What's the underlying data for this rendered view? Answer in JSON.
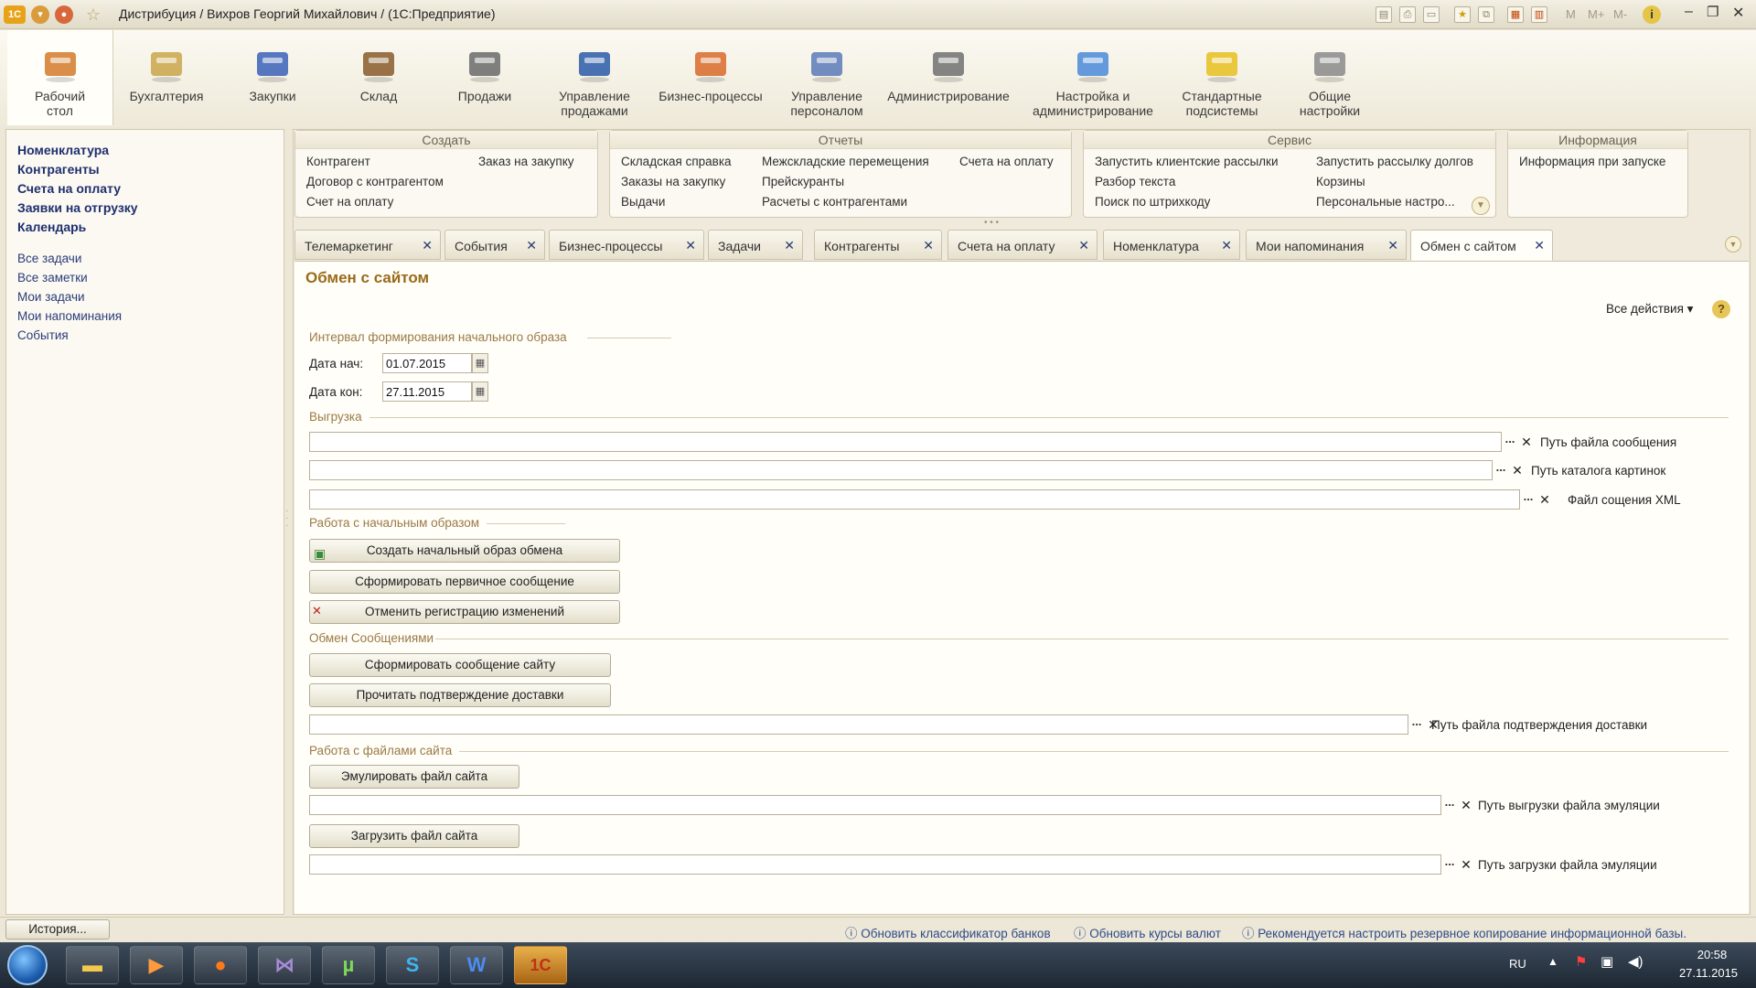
{
  "window": {
    "title": "Дистрибуция / Вихров Георгий Михайлович /  (1С:Предприятие)",
    "app_badge": "1С",
    "toolbar_letters": [
      "M",
      "M+",
      "M-"
    ]
  },
  "sections": [
    {
      "label": "Рабочий\nстол",
      "icon": "desktop-icon"
    },
    {
      "label": "Бухгалтерия",
      "icon": "coins-icon"
    },
    {
      "label": "Закупки",
      "icon": "truck-icon"
    },
    {
      "label": "Склад",
      "icon": "warehouse-icon"
    },
    {
      "label": "Продажи",
      "icon": "delivery-icon"
    },
    {
      "label": "Управление\nпродажами",
      "icon": "sales-chart-icon"
    },
    {
      "label": "Бизнес-процессы",
      "icon": "process-icon"
    },
    {
      "label": "Управление\nперсоналом",
      "icon": "people-icon"
    },
    {
      "label": "Администрирование",
      "icon": "tools-icon"
    },
    {
      "label": "Настройка и\nадминистрирование",
      "icon": "settings-server-icon"
    },
    {
      "label": "Стандартные\nподсистемы",
      "icon": "standard-icon"
    },
    {
      "label": "Общие\nнастройки",
      "icon": "gears-icon"
    }
  ],
  "sidebar": {
    "main": [
      "Номенклатура",
      "Контрагенты",
      "Счета на оплату",
      "Заявки на отгрузку",
      "Календарь"
    ],
    "secondary": [
      "Все задачи",
      "Все заметки",
      "Мои задачи",
      "Мои напоминания",
      "События"
    ],
    "history_button": "История..."
  },
  "groups": {
    "create": {
      "title": "Создать",
      "col1": [
        "Контрагент",
        "Договор с контрагентом",
        "Счет на оплату"
      ],
      "col2": [
        "Заказ на закупку"
      ]
    },
    "reports": {
      "title": "Отчеты",
      "col1": [
        "Складская справка",
        "Заказы на закупку",
        "Выдачи"
      ],
      "col2": [
        "Межскладские перемещения",
        "Прейскуранты",
        "Расчеты с контрагентами"
      ],
      "col3": [
        "Счета на оплату"
      ]
    },
    "service": {
      "title": "Сервис",
      "col1": [
        "Запустить клиентские рассылки",
        "Разбор текста",
        "Поиск по штрихкоду"
      ],
      "col2": [
        "Запустить рассылку долгов",
        "Корзины",
        "Персональные настро..."
      ]
    },
    "info": {
      "title": "Информация",
      "col1": [
        "Информация при запуске"
      ]
    }
  },
  "tabs": [
    "Телемаркетинг",
    "События",
    "Бизнес-процессы",
    "Задачи",
    "Контрагенты",
    "Счета на оплату",
    "Номенклатура",
    "Мои напоминания",
    "Обмен с сайтом"
  ],
  "form": {
    "title": "Обмен с сайтом",
    "all_actions": "Все действия",
    "interval": {
      "label": "Интервал формирования начального образа",
      "start_label": "Дата нач:",
      "start_value": "01.07.2015",
      "end_label": "Дата кон:",
      "end_value": "27.11.2015"
    },
    "export": {
      "label": "Выгрузка",
      "field1_label": "Путь файла сообщения",
      "field2_label": "Путь каталога картинок",
      "field3_label": "Файл сощения XML"
    },
    "initial": {
      "label": "Работа с начальным образом",
      "btn1": "Создать начальный образ обмена",
      "btn2": "Сформировать первичное сообщение",
      "btn3": "Отменить регистрацию изменений"
    },
    "messages": {
      "label": "Обмен Сообщениями",
      "btn1": "Сформировать сообщение сайту",
      "btn2": "Прочитать подтверждение доставки",
      "field_label": "Путь файла подтверждения доставки"
    },
    "site_files": {
      "label": "Работа с файлами сайта",
      "btn1": "Эмулировать файл сайта",
      "field1_label": "Путь выгрузки файла эмуляции",
      "btn2": "Загрузить файл сайта",
      "field2_label": "Путь загрузки файла эмуляции"
    }
  },
  "status_links": [
    "Обновить классификатор банков",
    "Обновить курсы валют",
    "Рекомендуется настроить резервное копирование информационной базы."
  ],
  "taskbar": {
    "lang": "RU",
    "time": "20:58",
    "date": "27.11.2015",
    "apps": [
      "explorer",
      "media-player",
      "firefox",
      "visual-studio",
      "utorrent",
      "skype",
      "word",
      "1c"
    ]
  }
}
